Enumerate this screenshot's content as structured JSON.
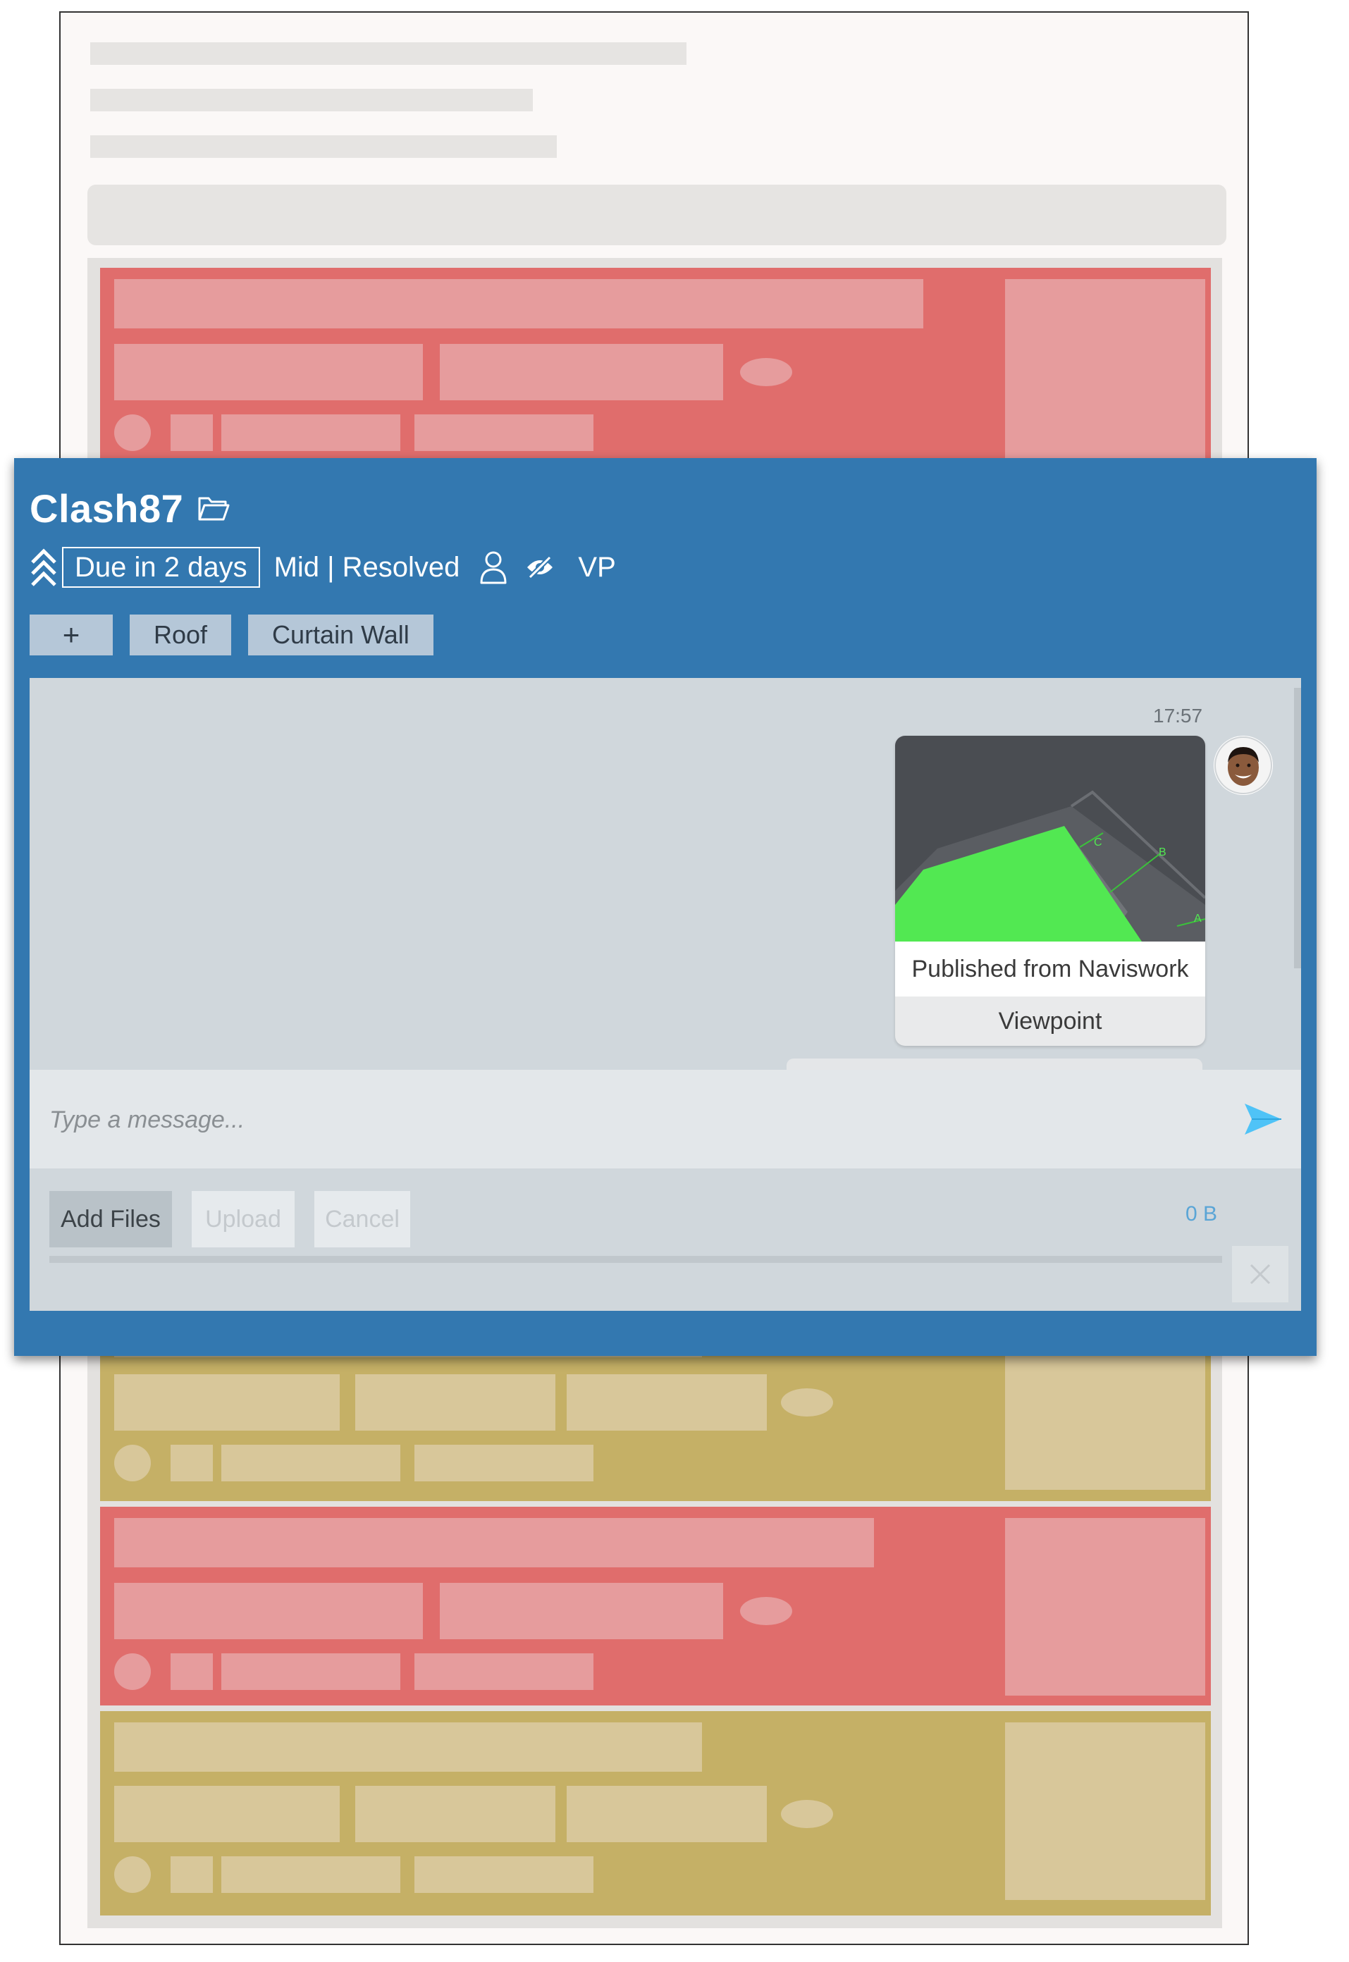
{
  "issue": {
    "title": "Clash87",
    "due": "Due in 2 days",
    "priority_status": "Mid | Resolved",
    "vp": "VP",
    "tags": [
      "Roof",
      "Curtain Wall"
    ],
    "add_tag": "+"
  },
  "chat": {
    "time": "17:57",
    "caption": "Published from Naviswork",
    "viewpoint": "Viewpoint",
    "thumb_labels": [
      "C",
      "B",
      "A"
    ],
    "placeholder": "Type a message..."
  },
  "upload": {
    "add_files": "Add Files",
    "upload": "Upload",
    "cancel": "Cancel",
    "size": "0 B",
    "progress": 0
  },
  "colors": {
    "header": "#3378b0",
    "item_red": "#e06d6c",
    "item_yellow": "#c5b066",
    "send": "#4fc3f7",
    "model_green": "#52e852"
  },
  "icons": [
    "folder-icon",
    "priority-chevrons-icon",
    "user-icon",
    "eye-slash-icon",
    "send-icon",
    "close-icon"
  ]
}
